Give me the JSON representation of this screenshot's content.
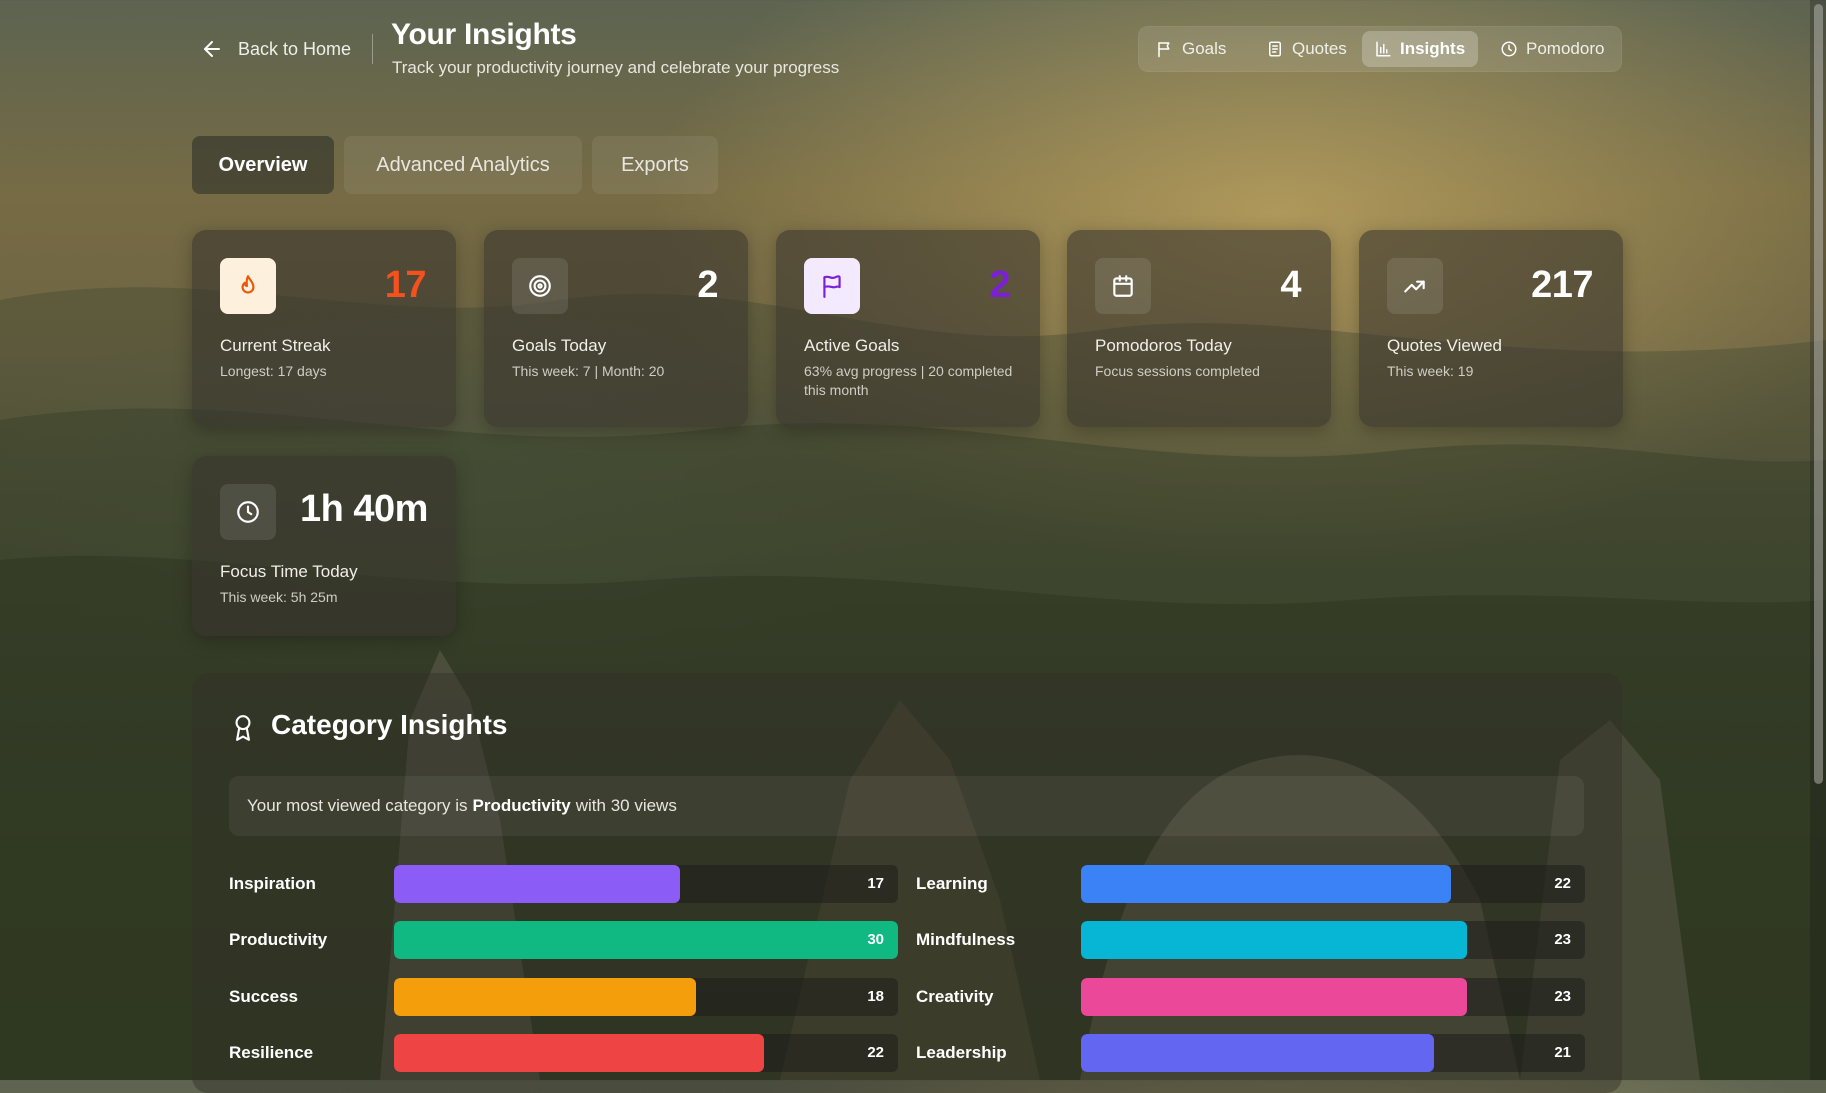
{
  "header": {
    "back_label": "Back to Home",
    "title": "Your Insights",
    "subtitle": "Track your productivity journey and celebrate your progress"
  },
  "topnav": [
    {
      "label": "Goals",
      "icon": "flag-icon",
      "active": false
    },
    {
      "label": "Quotes",
      "icon": "document-icon",
      "active": false
    },
    {
      "label": "Insights",
      "icon": "bar-chart-icon",
      "active": true
    },
    {
      "label": "Pomodoro",
      "icon": "clock-icon",
      "active": false
    }
  ],
  "tabs": [
    {
      "label": "Overview",
      "active": true
    },
    {
      "label": "Advanced Analytics",
      "active": false
    },
    {
      "label": "Exports",
      "active": false
    }
  ],
  "stats": {
    "streak": {
      "value": "17",
      "label": "Current Streak",
      "sub": "Longest: 17 days",
      "icon": "flame-icon",
      "value_color": "#f4511e",
      "icon_bg": "#fdf0dc"
    },
    "goals_today": {
      "value": "2",
      "label": "Goals Today",
      "sub": "This week: 7 | Month: 20",
      "icon": "target-icon"
    },
    "active_goals": {
      "value": "2",
      "label": "Active Goals",
      "sub": "63% avg progress | 20 completed this month",
      "icon": "flag-icon",
      "value_color": "#7c1fd9",
      "icon_bg": "#f3eaff"
    },
    "pomodoros_today": {
      "value": "4",
      "label": "Pomodoros Today",
      "sub": "Focus sessions completed",
      "icon": "calendar-icon"
    },
    "quotes_viewed": {
      "value": "217",
      "label": "Quotes Viewed",
      "sub": "This week: 19",
      "icon": "trending-up-icon"
    },
    "focus_time": {
      "value": "1h 40m",
      "label": "Focus Time Today",
      "sub": "This week: 5h 25m",
      "icon": "clock-icon"
    }
  },
  "category_insights": {
    "title": "Category Insights",
    "banner_prefix": "Your most viewed category is",
    "banner_category": "Productivity",
    "banner_suffix": "with 30 views",
    "max": 30,
    "left": [
      {
        "name": "Inspiration",
        "count": 17,
        "color": "#8b5cf6"
      },
      {
        "name": "Productivity",
        "count": 30,
        "color": "#10b981"
      },
      {
        "name": "Success",
        "count": 18,
        "color": "#f59e0b"
      },
      {
        "name": "Resilience",
        "count": 22,
        "color": "#ef4444"
      }
    ],
    "right": [
      {
        "name": "Learning",
        "count": 22,
        "color": "#3b82f6"
      },
      {
        "name": "Mindfulness",
        "count": 23,
        "color": "#06b6d4"
      },
      {
        "name": "Creativity",
        "count": 23,
        "color": "#ec4899"
      },
      {
        "name": "Leadership",
        "count": 21,
        "color": "#6366f1"
      }
    ]
  }
}
